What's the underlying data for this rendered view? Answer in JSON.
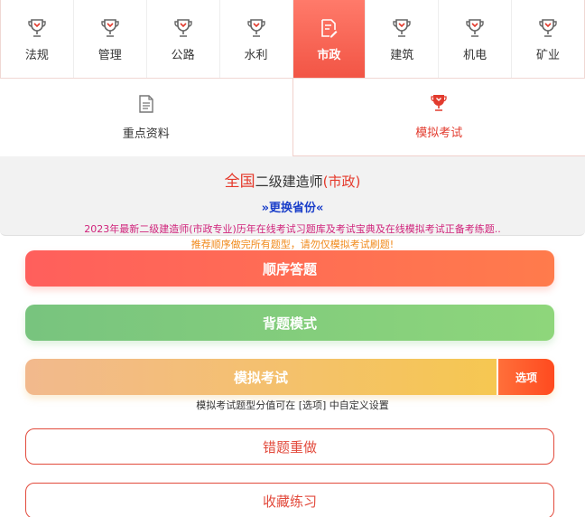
{
  "categories": [
    {
      "label": "法规",
      "icon": "trophy-icon",
      "active": false
    },
    {
      "label": "管理",
      "icon": "trophy-icon",
      "active": false
    },
    {
      "label": "公路",
      "icon": "trophy-icon",
      "active": false
    },
    {
      "label": "水利",
      "icon": "trophy-icon",
      "active": false
    },
    {
      "label": "市政",
      "icon": "document-edit-icon",
      "active": true
    },
    {
      "label": "建筑",
      "icon": "trophy-icon",
      "active": false
    },
    {
      "label": "机电",
      "icon": "trophy-icon",
      "active": false
    },
    {
      "label": "矿业",
      "icon": "trophy-icon",
      "active": false
    }
  ],
  "subtabs": [
    {
      "label": "重点资料",
      "icon": "document-icon",
      "active": false
    },
    {
      "label": "模拟考试",
      "icon": "trophy-icon",
      "active": true
    }
  ],
  "info": {
    "region": "全国",
    "exam": "二级建造师",
    "subject": "(市政)",
    "change_label": "»更换省份«"
  },
  "notices": {
    "line1": "2023年最新二级建造师(市政专业)历年在线考试习题库及考试宝典及在线模拟考试正备考练题..",
    "line2": "推荐顺序做完所有题型，请勿仅模拟考试刷题!"
  },
  "buttons": {
    "sequential": "顺序答题",
    "memorize": "背题模式",
    "mock": "模拟考试",
    "options": "选项",
    "mock_hint": "模拟考试题型分值可在 [选项] 中自定义设置",
    "wrong_redo": "错题重做",
    "favorites": "收藏练习"
  },
  "colors": {
    "accent_red": "#f25545",
    "link_blue": "#1a3ec9",
    "notice_pink": "#d0237b",
    "notice_orange": "#f08a1c"
  }
}
